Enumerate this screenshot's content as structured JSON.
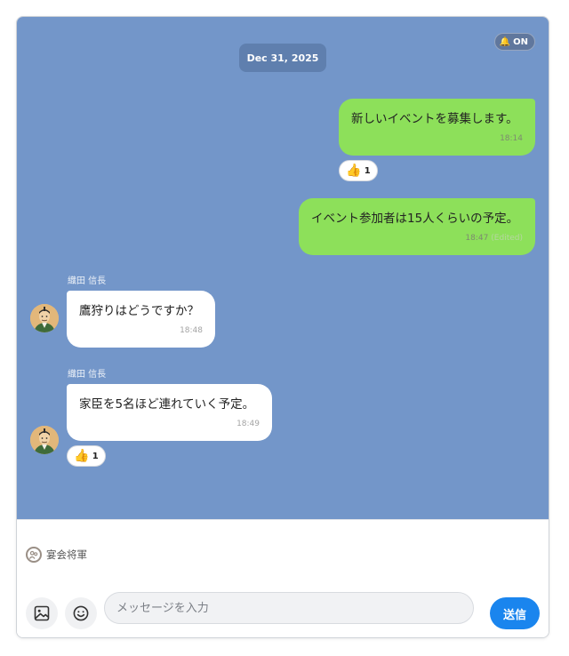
{
  "header": {
    "notification_label": "ON",
    "notification_icon": "bell-icon"
  },
  "chat": {
    "date_separator": "Dec 31, 2025",
    "messages": [
      {
        "direction": "outgoing",
        "text": "新しいイベントを募集します。",
        "time": "18:14",
        "reaction": {
          "emoji": "👍",
          "count": "1"
        }
      },
      {
        "direction": "outgoing",
        "text": "イベント参加者は15人くらいの予定。",
        "time": "18:47",
        "edited_label": "(Edited)"
      },
      {
        "direction": "incoming",
        "sender": "織田 信長",
        "text": "鷹狩りはどうですか？",
        "time": "18:48"
      },
      {
        "direction": "incoming",
        "sender": "織田 信長",
        "text": "家臣を5名ほど連れていく予定。",
        "time": "18:49",
        "reaction": {
          "emoji": "👍",
          "count": "1"
        }
      }
    ]
  },
  "composer": {
    "group_name": "宴会将軍",
    "input_placeholder": "メッセージを入力",
    "input_value": "",
    "send_label": "送信",
    "image_icon": "image-icon",
    "emoji_icon": "emoji-icon"
  },
  "colors": {
    "chat_background": "#7396c9",
    "outgoing_bubble": "#8de05a",
    "incoming_bubble": "#ffffff",
    "send_button": "#1a85ee"
  }
}
